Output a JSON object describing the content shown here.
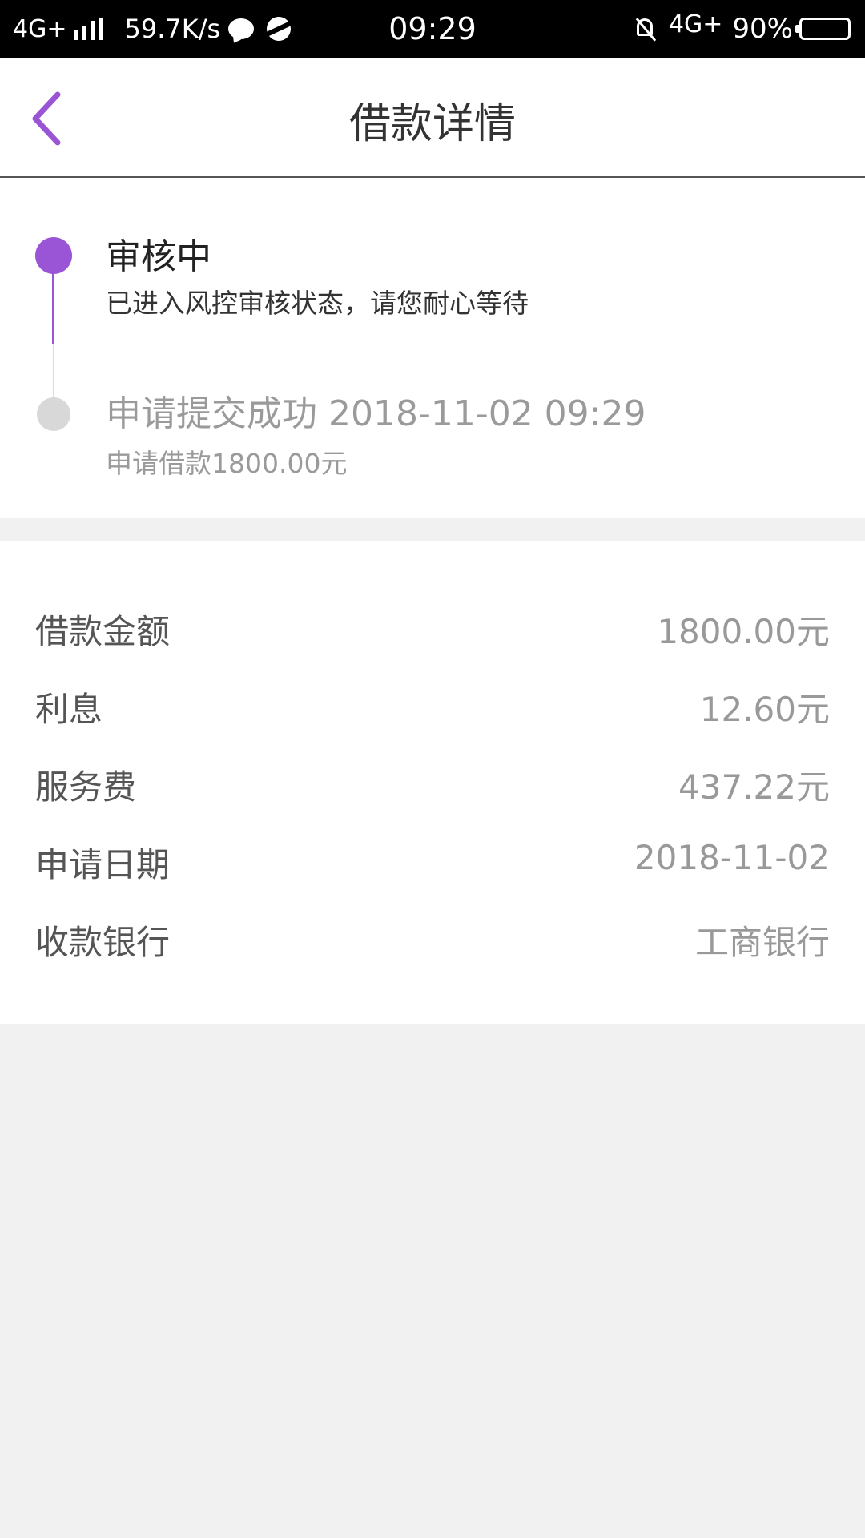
{
  "status_bar": {
    "network": "4G+",
    "speed": "59.7K/s",
    "time": "09:29",
    "network_right": "4G+",
    "battery": "90%"
  },
  "header": {
    "title": "借款详情",
    "back_icon": "chevron-left-icon"
  },
  "colors": {
    "accent": "#9a55d6",
    "inactive": "#d8d8d8"
  },
  "timeline": [
    {
      "title": "审核中",
      "description": "已进入风控审核状态，请您耐心等待"
    },
    {
      "title": "申请提交成功 2018-11-02 09:29",
      "description": "申请借款1800.00元"
    }
  ],
  "details": [
    {
      "label": "借款金额",
      "value": "1800.00元"
    },
    {
      "label": "利息",
      "value": "12.60元"
    },
    {
      "label": "服务费",
      "value": "437.22元"
    },
    {
      "label": "申请日期",
      "value": "2018-11-02"
    },
    {
      "label": "收款银行",
      "value": "工商银行"
    }
  ]
}
